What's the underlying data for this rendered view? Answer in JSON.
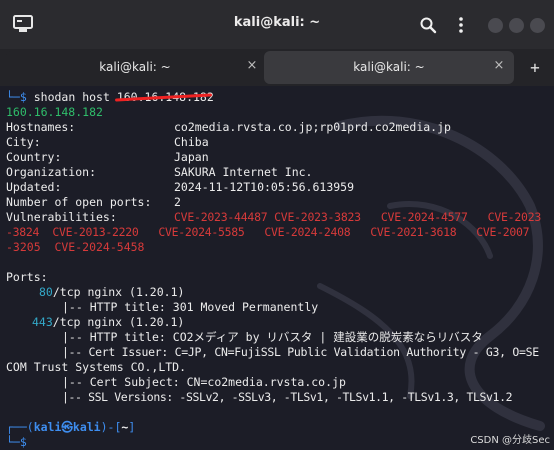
{
  "window": {
    "title": "kali@kali: ~"
  },
  "tabs": [
    {
      "label": "kali@kali: ~",
      "close": "×"
    },
    {
      "label": "kali@kali: ~",
      "close": "×"
    }
  ],
  "new_tab": "+",
  "terminal": {
    "prompt1_box": "└─",
    "prompt1_dollar": "$",
    "command": "shodan host ",
    "command_arg_redacted": "160.16.148.182",
    "ip": "160.16.148.182",
    "rows": [
      {
        "k": "Hostnames:",
        "v": "co2media.rvsta.co.jp;rp01prd.co2media.jp"
      },
      {
        "k": "City:",
        "v": "Chiba"
      },
      {
        "k": "Country:",
        "v": "Japan"
      },
      {
        "k": "Organization:",
        "v": "SAKURA Internet Inc."
      },
      {
        "k": "Updated:",
        "v": "2024-11-12T10:05:56.613959"
      },
      {
        "k": "Number of open ports:",
        "v": "2"
      }
    ],
    "vuln_label": "Vulnerabilities:",
    "vuln_line1": "CVE-2023-44487 CVE-2023-3823   CVE-2024-4577   CVE-2023",
    "vuln_line2": "-3824  CVE-2013-2220   CVE-2024-5585   CVE-2024-2408   CVE-2021-3618   CVE-2007",
    "vuln_line3": "-3205  CVE-2024-5458",
    "ports_label": "Ports:",
    "port1_num": "80",
    "port1_proto": "/tcp",
    "port1_svc": " nginx (1.20.1)",
    "port1_http": "|-- HTTP title: 301 Moved Permanently",
    "port2_num": "443",
    "port2_proto": "/tcp",
    "port2_svc": " nginx (1.20.1)",
    "port2_http": "|-- HTTP title: CO2メディア by リバスタ | 建設業の脱炭素ならリバスタ",
    "port2_issuer1": "|-- Cert Issuer: C=JP, CN=FujiSSL Public Validation Authority - G3, O=SE",
    "port2_issuer2": "COM Trust Systems CO.,LTD.",
    "port2_subject": "|-- Cert Subject: CN=co2media.rvsta.co.jp",
    "port2_ssl": "|-- SSL Versions: -SSLv2, -SSLv3, -TLSv1, -TLSv1.1, -TLSv1.3, TLSv1.2",
    "prompt2_open": "┌──(",
    "prompt2_user": "kali㉿kali",
    "prompt2_close": ")-[",
    "prompt2_dir": "~",
    "prompt2_end": "]",
    "prompt3_box": "└─",
    "prompt3_dollar": "$"
  },
  "watermark": "CSDN @分歧Sec",
  "icons": {
    "app": "terminal-app-icon",
    "search": "search-icon",
    "menu": "kebab-menu-icon",
    "close": "close-icon",
    "add": "plus-icon"
  }
}
